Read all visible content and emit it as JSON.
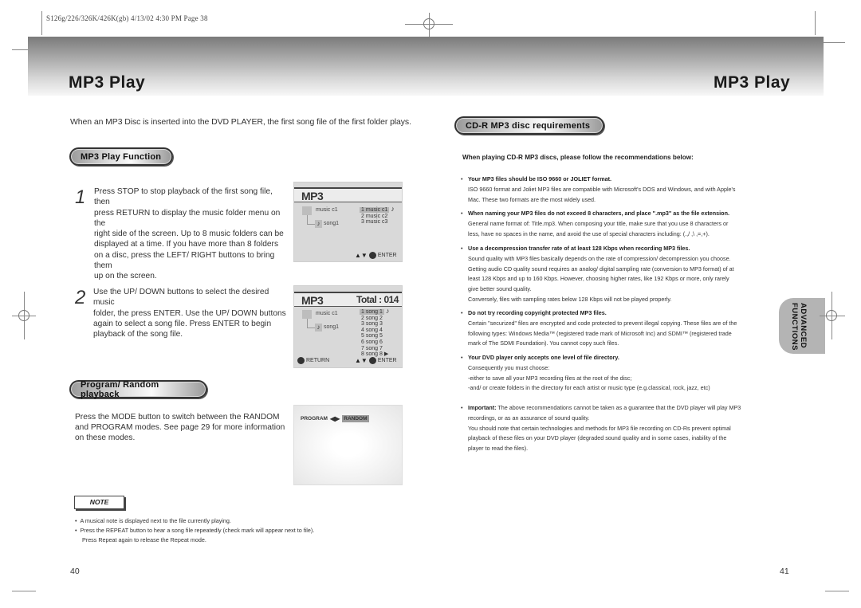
{
  "print_header": "S126g/226/326K/426K(gb)  4/13/02 4:30 PM  Page 38",
  "left_page": {
    "title": "MP3 Play",
    "intro": "When an MP3 Disc is inserted into the DVD PLAYER, the first song file of the first folder plays.",
    "section1_label": "MP3 Play Function",
    "steps": [
      {
        "number": "1",
        "lines": [
          "Press STOP to stop playback of the first song file, then",
          "press RETURN to display the music folder menu on the",
          "right side of the screen. Up to 8 music folders can be",
          "displayed at a time. If you have more than 8 folders",
          "on a disc, press the LEFT/ RIGHT buttons to bring them",
          "up on the screen."
        ]
      },
      {
        "number": "2",
        "lines": [
          "Use the UP/ DOWN buttons to select the desired music",
          "folder, the press ENTER. Use the UP/ DOWN buttons",
          "again to select a song file. Press ENTER to begin",
          "playback of the song file."
        ]
      }
    ],
    "osd1": {
      "title": "MP3",
      "folder": "music c1",
      "song": "song1",
      "items": [
        "1 music c1",
        "2 music c2",
        "3 music c3"
      ],
      "selected_index": 0,
      "playing_icon": "♪",
      "footer_enter": "ENTER"
    },
    "osd2": {
      "title": "MP3",
      "total": "Total : 014",
      "folder": "music c1",
      "song": "song1",
      "items": [
        "1 song 1",
        "2 song 2",
        "3 song 3",
        "4 song 4",
        "5 song 5",
        "6 song 6",
        "7 song 7",
        "8 song 8"
      ],
      "selected_index": 0,
      "playing_icon": "♪",
      "more_icon": "▶",
      "footer_return": "RETURN",
      "footer_enter": "ENTER"
    },
    "section2_label": "Program/ Random playback",
    "section2_lines": [
      "Press the MODE button to switch between the RANDOM",
      "and PROGRAM modes. See page 29 for more information",
      "on these modes."
    ],
    "osd3": {
      "left_label": "PROGRAM",
      "arrows": "◀▶",
      "right_label": "RANDOM"
    },
    "note_label": "NOTE",
    "notes": [
      "A musical note is displayed next to the file currently playing.",
      "Press the REPEAT button to hear a song file repeatedly (check mark will appear next to file).",
      "Press Repeat again to release the Repeat mode."
    ],
    "page_number": "40"
  },
  "right_page": {
    "title": "MP3 Play",
    "section_label": "CD-R MP3 disc requirements",
    "lead": "When playing CD-R MP3 discs, please follow the recommendations below:",
    "items": [
      {
        "heading": "Your MP3 files should be ISO 9660 or JOLIET format.",
        "lines": [
          "ISO 9660 format and Joliet MP3 files are compatible with Microsoft's DOS and Windows, and with Apple's",
          "Mac. These two formats are the most widely used."
        ]
      },
      {
        "heading": "When naming your MP3 files do not exceed 8 characters, and place \".mp3\" as the file extension.",
        "lines": [
          "General name format of: Title.mp3. When composing your title, make sure that you use 8 characters or",
          "less, have no spaces in the name, and avoid the use of special characters including: (.,/ ,\\ ,=,+)."
        ]
      },
      {
        "heading": "Use a decompression transfer rate of at least 128 Kbps when recording MP3 files.",
        "lines": [
          "Sound quality with MP3 files basically depends on the rate of compression/ decompression you choose.",
          "Getting audio CD quality sound requires an analog/ digital sampling rate (conversion to MP3 format) of at",
          "least 128 Kbps and up to 160 Kbps. However, choosing higher rates, like 192 Kbps or more, only rarely",
          "give better sound quality.",
          "Conversely, files with sampling rates below 128 Kbps will not be played properly."
        ]
      },
      {
        "heading": "Do not try recording copyright protected MP3 files.",
        "lines": [
          "Certain \"securized\" files are encrypted and code protected to prevent illegal copying. These files are of the",
          "following types: Windows Media™ (registered trade mark of Microsoft Inc) and SDMI™ (registered trade",
          "mark of The SDMI Foundation). You cannot copy such files."
        ]
      },
      {
        "heading": "Your DVD player only accepts one level of file directory.",
        "lines": [
          "Consequently you must choose:",
          "-either to save all your MP3 recording files at the root of the disc;",
          "-and/ or create folders in the directory for each artist or music type (e.g.classical, rock, jazz, etc)"
        ]
      },
      {
        "heading": "Important:",
        "heading_rest": " The above recommendations cannot be taken as a guarantee that the DVD player will play MP3",
        "lines": [
          "recordings, or as an assurance of sound quality.",
          "You should note that certain technologies and methods for MP3 file recording on CD-Rs prevent optimal",
          "playback of these files on your DVD player (degraded sound quality and in some cases, inability of the",
          "player to read the files)."
        ]
      }
    ],
    "side_tab": [
      "ADVANCED",
      "FUNCTIONS"
    ],
    "page_number": "41"
  }
}
